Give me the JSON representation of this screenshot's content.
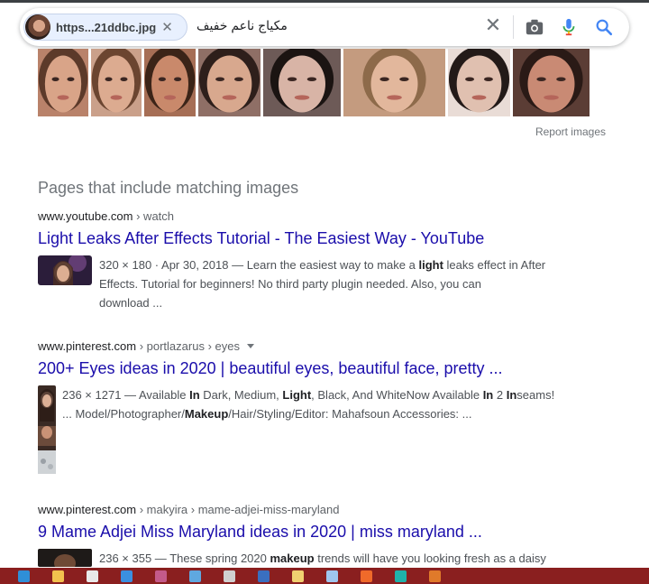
{
  "search": {
    "image_chip_label": "https...21ddbc.jpg",
    "query": "مكياج ناعم خفيف"
  },
  "image_strip": {
    "thumbnails": [
      {
        "name": "face-thumb-1",
        "skin": "#d9a488",
        "hair": "#5c3a2a",
        "bg": "#b9826a"
      },
      {
        "name": "face-thumb-2",
        "skin": "#dcab90",
        "hair": "#6b4530",
        "bg": "#caa08a"
      },
      {
        "name": "face-thumb-3",
        "skin": "#c9896b",
        "hair": "#3b2418",
        "bg": "#a66e55"
      },
      {
        "name": "face-thumb-4",
        "skin": "#d8a88e",
        "hair": "#2e1f1b",
        "bg": "#8f6f66"
      },
      {
        "name": "face-thumb-5",
        "skin": "#d8b4a6",
        "hair": "#1b1412",
        "bg": "#6d5a57"
      },
      {
        "name": "face-thumb-6",
        "skin": "#e2b79c",
        "hair": "#8d6a4a",
        "bg": "#c49b7f"
      },
      {
        "name": "face-thumb-7",
        "skin": "#e0c0b0",
        "hair": "#231a18",
        "bg": "#e9dcd6"
      },
      {
        "name": "face-thumb-8",
        "skin": "#c98a74",
        "hair": "#2a1a16",
        "bg": "#5b3d35"
      }
    ],
    "report_label": "Report images"
  },
  "section_title": "Pages that include matching images",
  "results": [
    {
      "site": "www.youtube.com",
      "path": " › watch",
      "has_menu": false,
      "title": "Light Leaks After Effects Tutorial - The Easiest Way - YouTube",
      "meta": "320 × 180 · Apr 30, 2018 — ",
      "line1_a": "Learn the easiest way to make a ",
      "line1_b": "light",
      "line1_c": " leaks effect in After",
      "line2": "Effects. Tutorial for beginners! No third party plugin needed. Also, you can",
      "line3": "download ..."
    },
    {
      "site": "www.pinterest.com",
      "path": " › portlazarus › eyes",
      "has_menu": true,
      "title": "200+ Eyes ideas in 2020 | beautiful eyes, beautiful face, pretty ...",
      "meta": "236 × 1271 — ",
      "line1_a": "Available ",
      "line1_b": "In",
      "line1_c": " Dark, Medium, ",
      "line1_d": "Light",
      "line1_e": ", Black, And WhiteNow Available ",
      "line1_f": "In",
      "line1_g": " 2 ",
      "line1_h": "In",
      "line1_i": "seams!",
      "line2_a": "... Model/Photographer/",
      "line2_b": "Makeup",
      "line2_c": "/Hair/Styling/Editor: Mahafsoun Accessories: ..."
    },
    {
      "site": "www.pinterest.com",
      "path": " › makyira › mame-adjei-miss-maryland",
      "has_menu": false,
      "title": "9 Mame Adjei Miss Maryland ideas in 2020 | miss maryland ...",
      "meta": "236 × 355 — ",
      "line1_a": "These spring 2020 ",
      "line1_b": "makeup",
      "line1_c": " trends will have you looking fresh as a daisy"
    }
  ],
  "taskbar": {
    "color": "#8a1f1f",
    "icons": [
      {
        "name": "edge-icon",
        "color": "#2f8fd8"
      },
      {
        "name": "file-explorer-icon",
        "color": "#f2c14e"
      },
      {
        "name": "store-icon",
        "color": "#e8e8e8"
      },
      {
        "name": "mail-icon",
        "color": "#3b8fe0"
      },
      {
        "name": "photos-icon",
        "color": "#c45a8a"
      },
      {
        "name": "app-icon",
        "color": "#5fa8e0"
      },
      {
        "name": "settings-icon",
        "color": "#d0d0d0"
      },
      {
        "name": "app-icon-2",
        "color": "#3a6fc0"
      },
      {
        "name": "paint-icon",
        "color": "#f0d070"
      },
      {
        "name": "notepad-icon",
        "color": "#9fc6ee"
      },
      {
        "name": "brave-icon",
        "color": "#f06a2a"
      },
      {
        "name": "media-player-icon",
        "color": "#20b2aa"
      },
      {
        "name": "app-icon-3",
        "color": "#e07a2a"
      }
    ]
  }
}
